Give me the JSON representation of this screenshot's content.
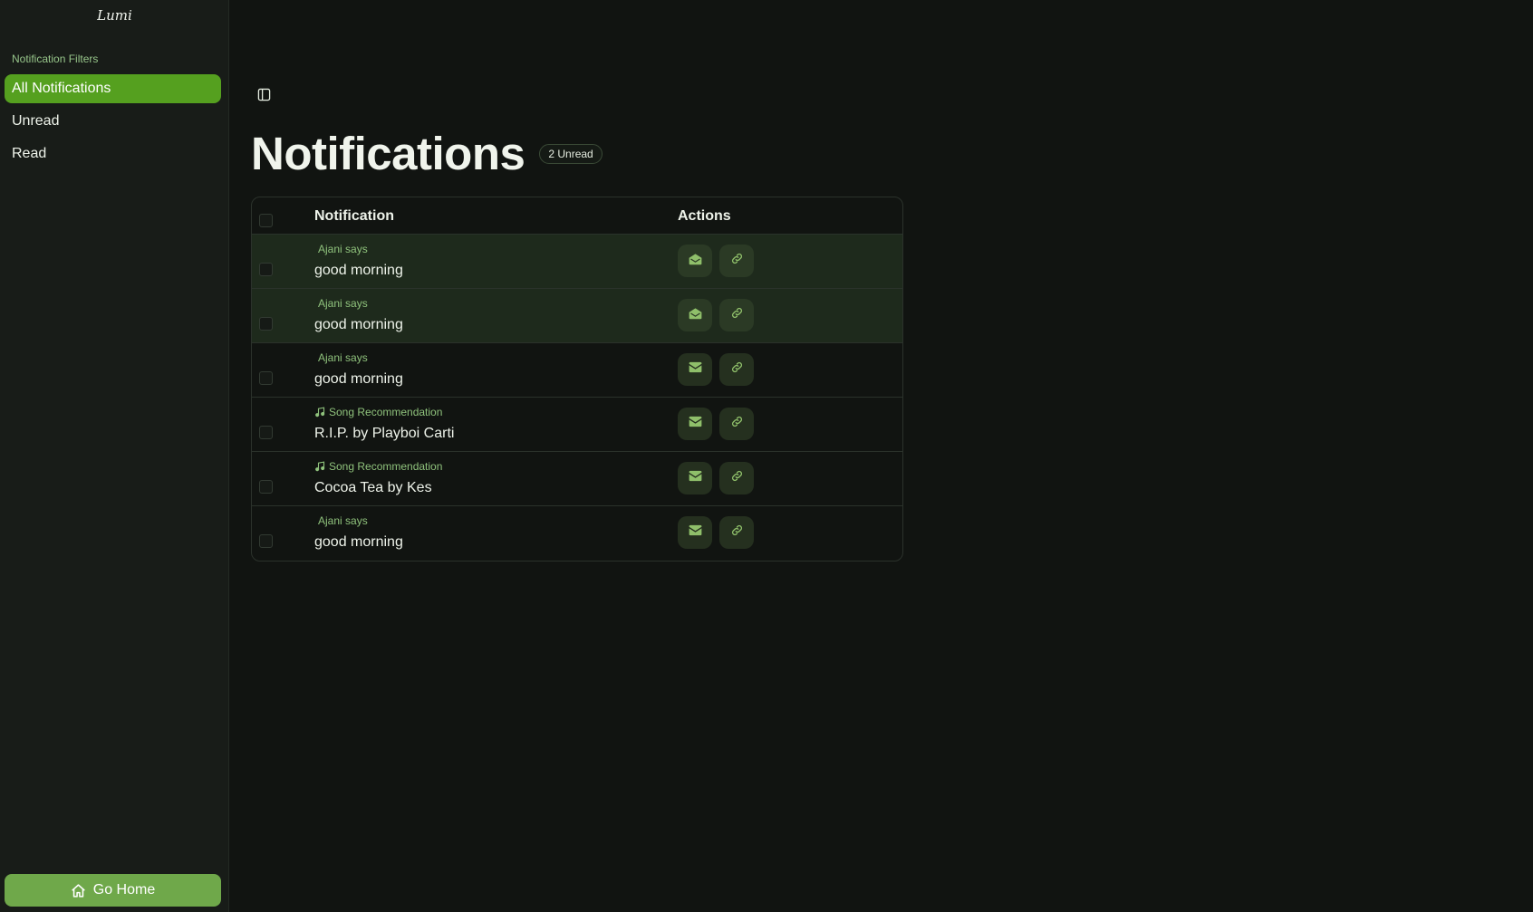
{
  "app": {
    "brand": "Lumi"
  },
  "sidebar": {
    "section_label": "Notification Filters",
    "items": [
      {
        "label": "All Notifications",
        "active": true
      },
      {
        "label": "Unread",
        "active": false
      },
      {
        "label": "Read",
        "active": false
      }
    ],
    "home_button": "Go Home"
  },
  "main": {
    "title": "Notifications",
    "badge": "2 Unread"
  },
  "table": {
    "headers": {
      "notification": "Notification",
      "actions": "Actions"
    },
    "rows": [
      {
        "sender": "Ajani says",
        "message": "good morning",
        "unread": true,
        "icon": "none"
      },
      {
        "sender": "Ajani says",
        "message": "good morning",
        "unread": true,
        "icon": "none"
      },
      {
        "sender": "Ajani says",
        "message": "good morning",
        "unread": false,
        "icon": "none"
      },
      {
        "sender": "Song Recommendation",
        "message": "R.I.P. by Playboi Carti",
        "unread": false,
        "icon": "music-note-icon"
      },
      {
        "sender": "Song Recommendation",
        "message": "Cocoa Tea by Kes",
        "unread": false,
        "icon": "music-note-icon"
      },
      {
        "sender": "Ajani says",
        "message": "good morning",
        "unread": false,
        "icon": "none"
      }
    ]
  },
  "colors": {
    "background": "#111411",
    "sidebar": "#181c18",
    "accent": "#55a01f",
    "home_button": "#6fa84a",
    "sender_text": "#8fc27c",
    "unread_row": "#1e2a1c"
  }
}
